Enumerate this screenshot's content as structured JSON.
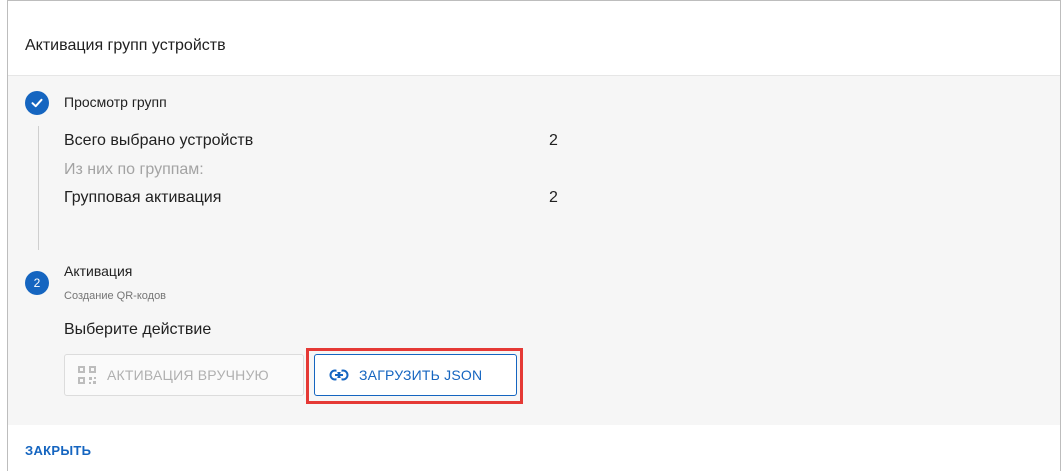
{
  "dialog": {
    "title": "Активация групп устройств",
    "close_label": "ЗАКРЫТЬ"
  },
  "step1": {
    "icon": "check-icon",
    "label": "Просмотр групп",
    "rows": [
      {
        "label": "Всего выбрано устройств",
        "value": "2"
      },
      {
        "label": "Из них по группам:",
        "value": ""
      },
      {
        "label": "Групповая активация",
        "value": "2"
      }
    ]
  },
  "step2": {
    "number": "2",
    "label": "Активация",
    "sublabel": "Создание QR-кодов",
    "choose_label": "Выберите действие",
    "manual_button": {
      "label": "АКТИВАЦИЯ ВРУЧНУЮ",
      "icon": "qr-code-icon"
    },
    "json_button": {
      "label": "ЗАГРУЗИТЬ JSON",
      "icon": "link-icon"
    }
  },
  "colors": {
    "accent": "#1565c0",
    "highlight": "#e53935",
    "content_bg": "#f6f6f6"
  }
}
